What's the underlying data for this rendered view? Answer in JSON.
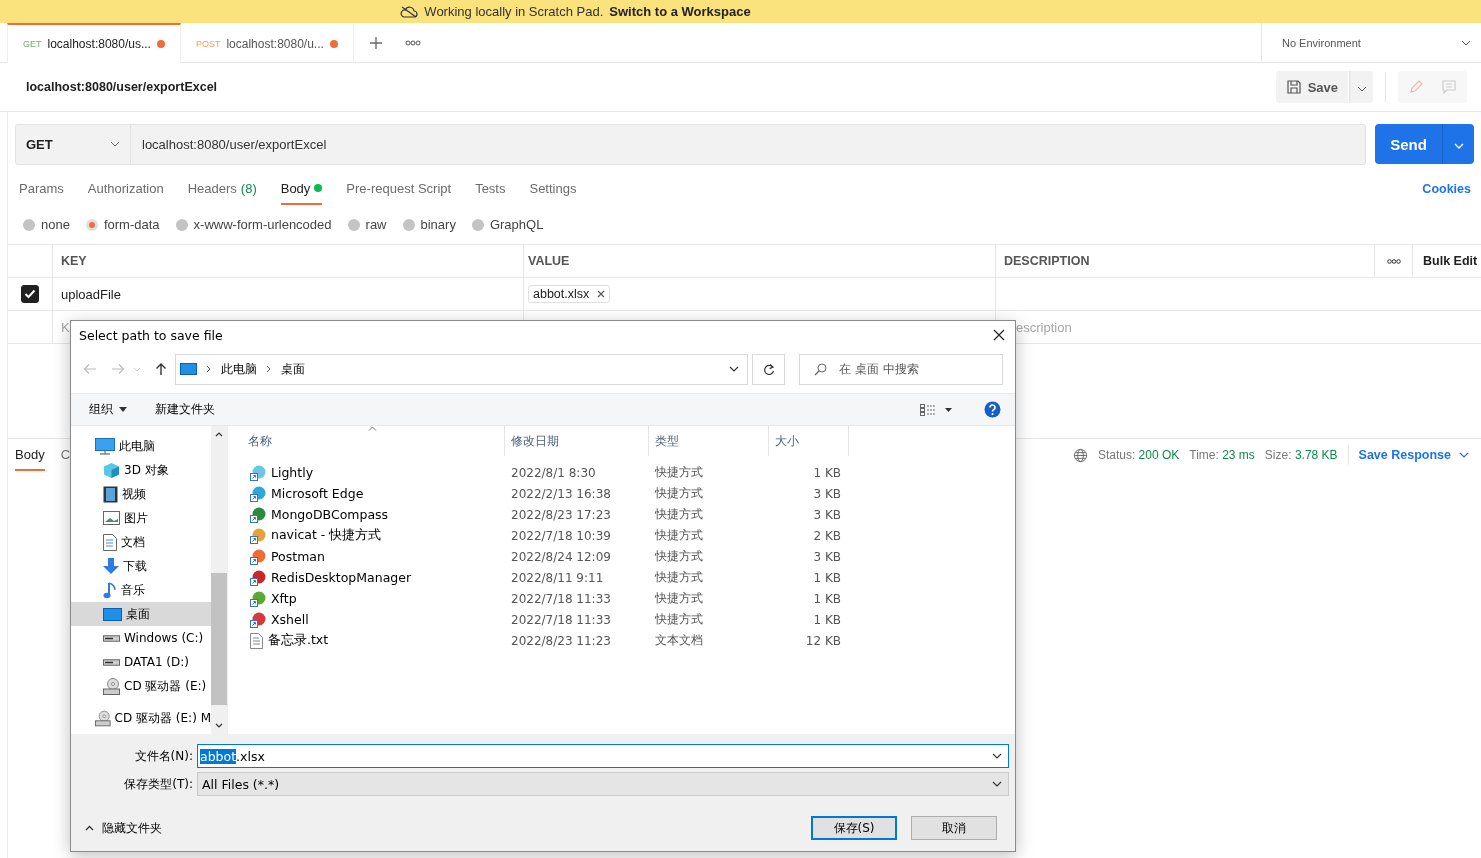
{
  "banner": {
    "text": "Working locally in Scratch Pad.",
    "link": "Switch to a Workspace"
  },
  "tabs": [
    {
      "method": "GET",
      "title": "localhost:8080/us...",
      "selected": true,
      "unsaved": true
    },
    {
      "method": "POST",
      "title": "localhost:8080/u...",
      "selected": false,
      "unsaved": true
    }
  ],
  "environment": "No Environment",
  "request": {
    "name": "localhost:8080/user/exportExcel",
    "save_label": "Save",
    "method": "GET",
    "url": "localhost:8080/user/exportExcel",
    "send_label": "Send"
  },
  "request_tabs": [
    {
      "label": "Params",
      "selected": false
    },
    {
      "label": "Authorization",
      "selected": false
    },
    {
      "label": "Headers",
      "count": "(8)",
      "selected": false
    },
    {
      "label": "Body",
      "selected": true,
      "dot": true
    },
    {
      "label": "Pre-request Script",
      "selected": false
    },
    {
      "label": "Tests",
      "selected": false
    },
    {
      "label": "Settings",
      "selected": false
    }
  ],
  "cookies": "Cookies",
  "body_modes": [
    {
      "label": "none",
      "selected": false
    },
    {
      "label": "form-data",
      "selected": true
    },
    {
      "label": "x-www-form-urlencoded",
      "selected": false
    },
    {
      "label": "raw",
      "selected": false
    },
    {
      "label": "binary",
      "selected": false
    },
    {
      "label": "GraphQL",
      "selected": false
    }
  ],
  "params_table": {
    "columns": [
      "KEY",
      "VALUE",
      "DESCRIPTION"
    ],
    "bulk_edit": "Bulk Edit",
    "rows": [
      {
        "checked": true,
        "key": "uploadFile",
        "file": "abbot.xlsx"
      }
    ],
    "placeholder_row": {
      "key": "K",
      "description": "escription"
    }
  },
  "response": {
    "tabs": [
      {
        "label": "Body",
        "selected": true
      },
      {
        "label": "C",
        "selected": false
      }
    ],
    "status_label": "Status:",
    "status": "200 OK",
    "time_label": "Time:",
    "time": "23 ms",
    "size_label": "Size:",
    "size": "3.78 KB",
    "save_response": "Save Response"
  },
  "dialog": {
    "title": "Select path to save file",
    "breadcrumb": [
      "此电脑",
      "桌面"
    ],
    "search_placeholder": "在 桌面 中搜索",
    "organize": "组织",
    "new_folder": "新建文件夹",
    "nav": [
      {
        "label": "此电脑",
        "kind": "computer",
        "selected": false,
        "children": [
          {
            "label": "3D 对象",
            "kind": "cube",
            "selected": false
          },
          {
            "label": "视频",
            "kind": "film",
            "selected": false
          },
          {
            "label": "图片",
            "kind": "picture",
            "selected": false
          },
          {
            "label": "文档",
            "kind": "document",
            "selected": false
          },
          {
            "label": "下载",
            "kind": "download",
            "selected": false
          },
          {
            "label": "音乐",
            "kind": "music",
            "selected": false
          },
          {
            "label": "桌面",
            "kind": "desktop",
            "selected": true
          },
          {
            "label": "Windows (C:)",
            "kind": "drive",
            "selected": false
          },
          {
            "label": "DATA1 (D:)",
            "kind": "drive",
            "selected": false
          },
          {
            "label": "CD 驱动器 (E:)",
            "kind": "cd",
            "selected": false
          }
        ]
      },
      {
        "label": "CD 驱动器 (E:) M",
        "kind": "cd",
        "selected": false
      }
    ],
    "columns": [
      "名称",
      "修改日期",
      "类型",
      "大小"
    ],
    "files": [
      {
        "name": "Lightly",
        "modified": "2022/8/1 8:30",
        "type": "快捷方式",
        "size": "1 KB",
        "kind": "shortcut",
        "color": "#6cc6e8"
      },
      {
        "name": "Microsoft Edge",
        "modified": "2022/2/13 16:38",
        "type": "快捷方式",
        "size": "3 KB",
        "kind": "shortcut",
        "color": "#2fa8d8"
      },
      {
        "name": "MongoDBCompass",
        "modified": "2022/8/23 17:23",
        "type": "快捷方式",
        "size": "3 KB",
        "kind": "shortcut",
        "color": "#2a8a3e"
      },
      {
        "name": "navicat - 快捷方式",
        "modified": "2022/7/18 10:39",
        "type": "快捷方式",
        "size": "2 KB",
        "kind": "shortcut",
        "color": "#e8a13a"
      },
      {
        "name": "Postman",
        "modified": "2022/8/24 12:09",
        "type": "快捷方式",
        "size": "3 KB",
        "kind": "shortcut",
        "color": "#ef6c37"
      },
      {
        "name": "RedisDesktopManager",
        "modified": "2022/8/11 9:11",
        "type": "快捷方式",
        "size": "1 KB",
        "kind": "shortcut",
        "color": "#c8282a"
      },
      {
        "name": "Xftp",
        "modified": "2022/7/18 11:33",
        "type": "快捷方式",
        "size": "1 KB",
        "kind": "shortcut",
        "color": "#5ba834"
      },
      {
        "name": "Xshell",
        "modified": "2022/7/18 11:33",
        "type": "快捷方式",
        "size": "1 KB",
        "kind": "shortcut",
        "color": "#d83a3a"
      },
      {
        "name": "备忘录.txt",
        "modified": "2022/8/23 11:23",
        "type": "文本文档",
        "size": "12 KB",
        "kind": "document",
        "color": "#888888"
      }
    ],
    "filename_label": "文件名(N):",
    "filename": {
      "selected_part": "abbot",
      "rest": ".xlsx"
    },
    "filetype_label": "保存类型(T):",
    "filetype": "All Files (*.*)",
    "hide_folders": "隐藏文件夹",
    "save_button": "保存(S)",
    "cancel_button": "取消"
  }
}
